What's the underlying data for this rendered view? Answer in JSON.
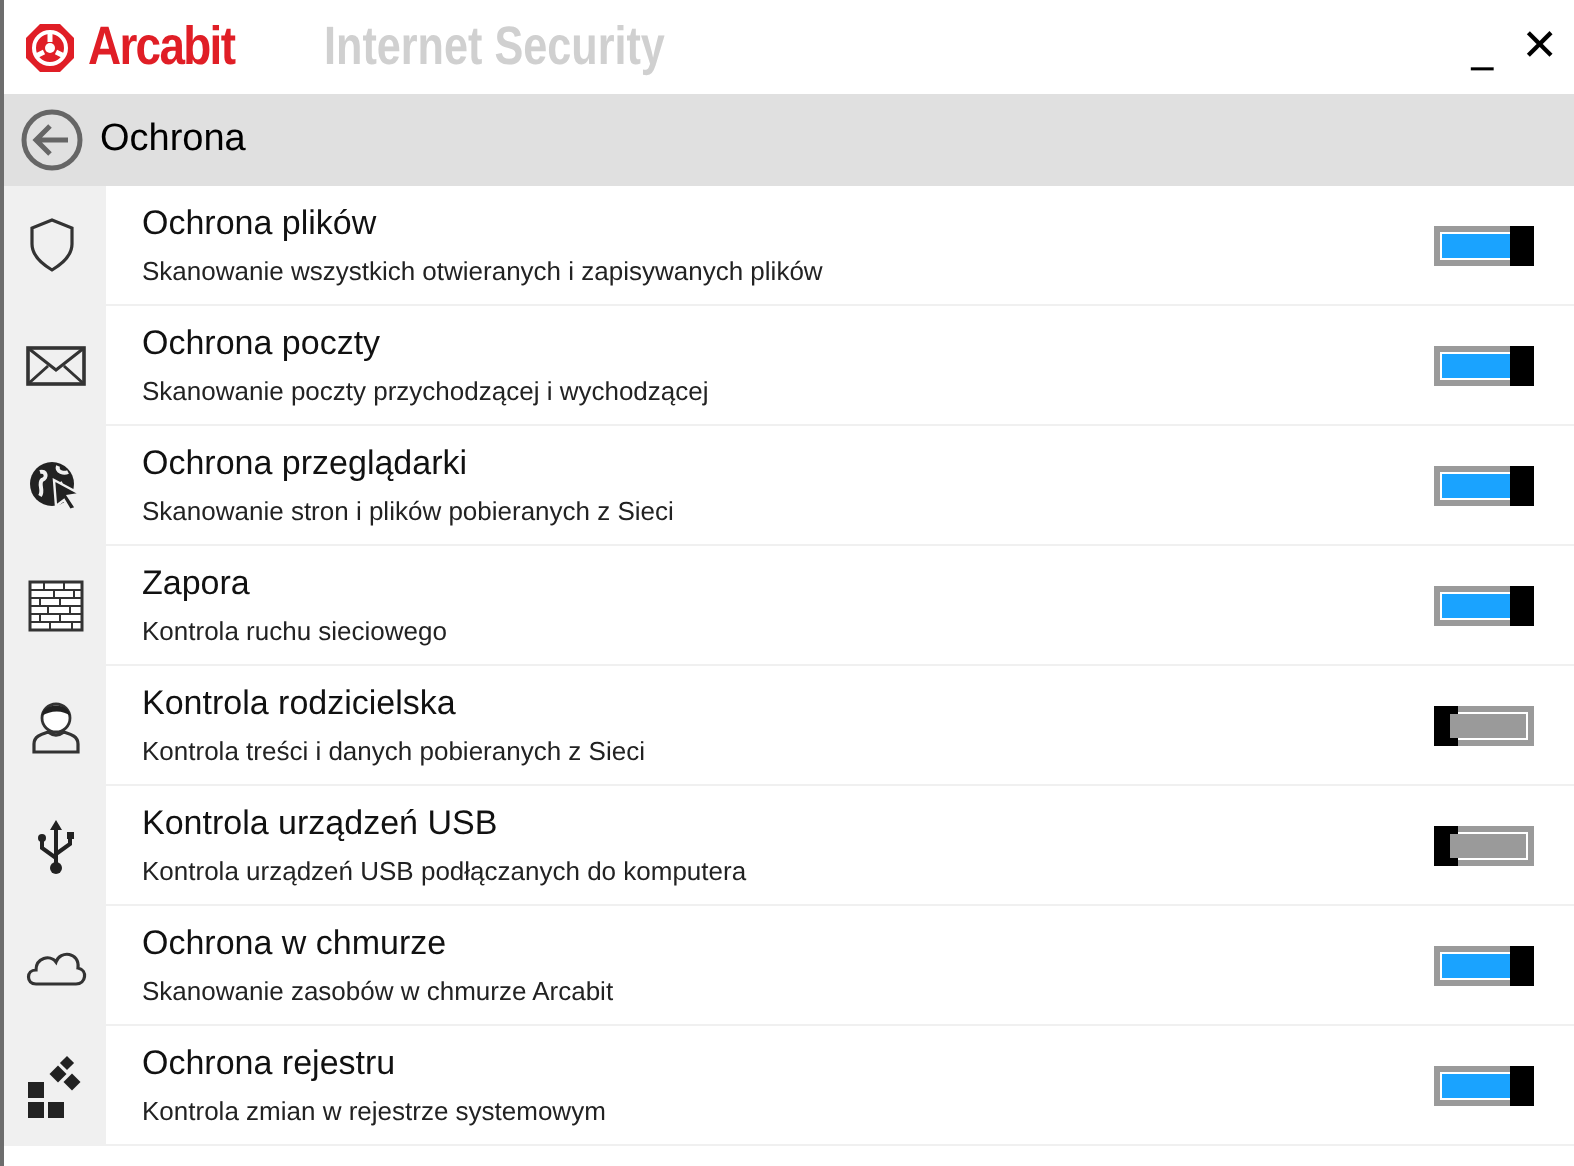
{
  "header": {
    "brand": "Arcabit",
    "product": "Internet Security",
    "minimize": "_",
    "close": "✕"
  },
  "section": {
    "title": "Ochrona"
  },
  "features": [
    {
      "title": "Ochrona plików",
      "description": "Skanowanie wszystkich otwieranych i zapisywanych plików",
      "on": true
    },
    {
      "title": "Ochrona poczty",
      "description": "Skanowanie poczty przychodzącej i wychodzącej",
      "on": true
    },
    {
      "title": "Ochrona przeglądarki",
      "description": "Skanowanie stron i plików pobieranych z Sieci",
      "on": true
    },
    {
      "title": "Zapora",
      "description": "Kontrola ruchu sieciowego",
      "on": true
    },
    {
      "title": "Kontrola rodzicielska",
      "description": "Kontrola treści i danych pobieranych z Sieci",
      "on": false
    },
    {
      "title": "Kontrola urządzeń USB",
      "description": "Kontrola urządzeń USB podłączanych do komputera",
      "on": false
    },
    {
      "title": "Ochrona w chmurze",
      "description": "Skanowanie zasobów w chmurze Arcabit",
      "on": true
    },
    {
      "title": "Ochrona rejestru",
      "description": "Kontrola zmian w rejestrze systemowym",
      "on": true
    }
  ]
}
